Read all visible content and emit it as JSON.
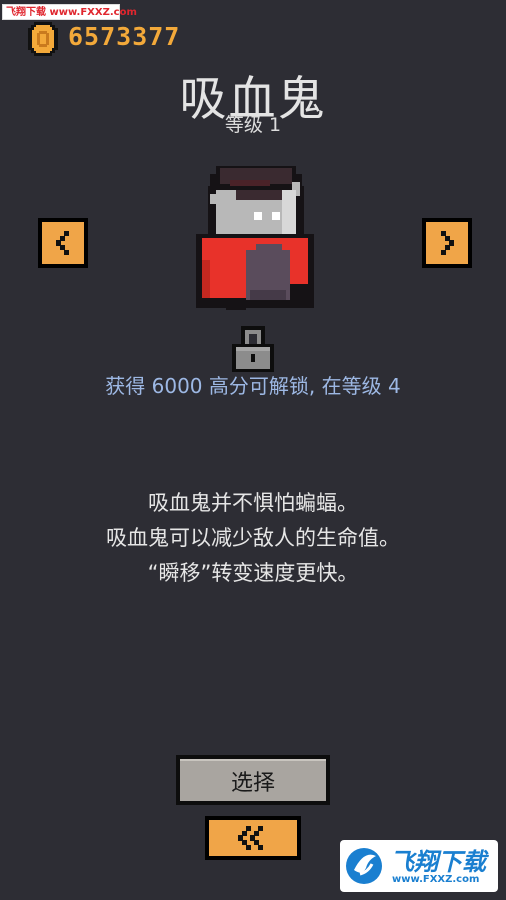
{
  "watermark_top": "飞翔下载 www.FXXZ.com",
  "coins": "6573377",
  "character": {
    "name": "吸血鬼",
    "level": "等级 1"
  },
  "unlock": {
    "text": "获得 6000 高分可解锁, 在等级 4"
  },
  "description": [
    "吸血鬼并不惧怕蝙蝠。",
    "吸血鬼可以减少敌人的生命值。",
    "“瞬移”转变速度更快。"
  ],
  "buttons": {
    "select_label": "选择"
  },
  "watermark_bottom": {
    "brand": "飞翔下载",
    "url": "www.FXXZ.com"
  },
  "colors": {
    "background": "#2d2d34",
    "coin_text": "#f3a93a",
    "button_orange": "#f0a548",
    "unlock_text": "#9db8e4",
    "select_button": "#a9a5a0"
  },
  "icons": {
    "coin": "coin-icon",
    "prev": "chevron-left-icon",
    "next": "chevron-right-icon",
    "lock": "padlock-icon",
    "back": "double-chevron-left-icon"
  }
}
